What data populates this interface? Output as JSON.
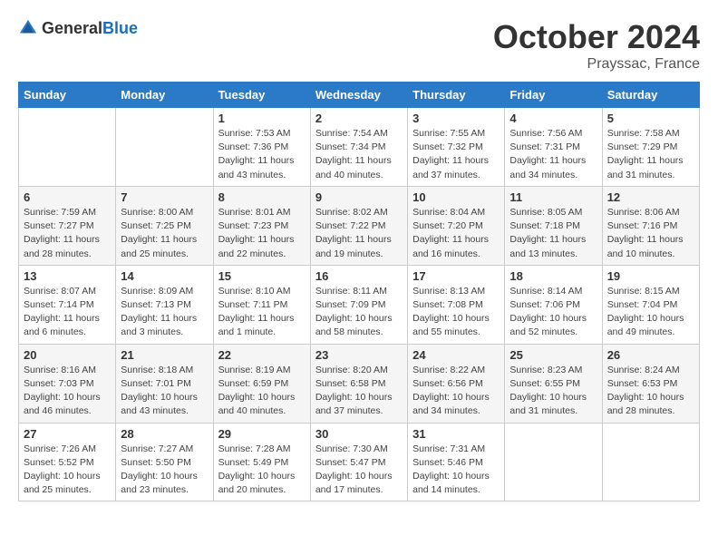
{
  "logo": {
    "text_general": "General",
    "text_blue": "Blue"
  },
  "title": "October 2024",
  "subtitle": "Prayssac, France",
  "headers": [
    "Sunday",
    "Monday",
    "Tuesday",
    "Wednesday",
    "Thursday",
    "Friday",
    "Saturday"
  ],
  "weeks": [
    [
      {
        "day": "",
        "info": ""
      },
      {
        "day": "",
        "info": ""
      },
      {
        "day": "1",
        "info": "Sunrise: 7:53 AM\nSunset: 7:36 PM\nDaylight: 11 hours\nand 43 minutes."
      },
      {
        "day": "2",
        "info": "Sunrise: 7:54 AM\nSunset: 7:34 PM\nDaylight: 11 hours\nand 40 minutes."
      },
      {
        "day": "3",
        "info": "Sunrise: 7:55 AM\nSunset: 7:32 PM\nDaylight: 11 hours\nand 37 minutes."
      },
      {
        "day": "4",
        "info": "Sunrise: 7:56 AM\nSunset: 7:31 PM\nDaylight: 11 hours\nand 34 minutes."
      },
      {
        "day": "5",
        "info": "Sunrise: 7:58 AM\nSunset: 7:29 PM\nDaylight: 11 hours\nand 31 minutes."
      }
    ],
    [
      {
        "day": "6",
        "info": "Sunrise: 7:59 AM\nSunset: 7:27 PM\nDaylight: 11 hours\nand 28 minutes."
      },
      {
        "day": "7",
        "info": "Sunrise: 8:00 AM\nSunset: 7:25 PM\nDaylight: 11 hours\nand 25 minutes."
      },
      {
        "day": "8",
        "info": "Sunrise: 8:01 AM\nSunset: 7:23 PM\nDaylight: 11 hours\nand 22 minutes."
      },
      {
        "day": "9",
        "info": "Sunrise: 8:02 AM\nSunset: 7:22 PM\nDaylight: 11 hours\nand 19 minutes."
      },
      {
        "day": "10",
        "info": "Sunrise: 8:04 AM\nSunset: 7:20 PM\nDaylight: 11 hours\nand 16 minutes."
      },
      {
        "day": "11",
        "info": "Sunrise: 8:05 AM\nSunset: 7:18 PM\nDaylight: 11 hours\nand 13 minutes."
      },
      {
        "day": "12",
        "info": "Sunrise: 8:06 AM\nSunset: 7:16 PM\nDaylight: 11 hours\nand 10 minutes."
      }
    ],
    [
      {
        "day": "13",
        "info": "Sunrise: 8:07 AM\nSunset: 7:14 PM\nDaylight: 11 hours\nand 6 minutes."
      },
      {
        "day": "14",
        "info": "Sunrise: 8:09 AM\nSunset: 7:13 PM\nDaylight: 11 hours\nand 3 minutes."
      },
      {
        "day": "15",
        "info": "Sunrise: 8:10 AM\nSunset: 7:11 PM\nDaylight: 11 hours\nand 1 minute."
      },
      {
        "day": "16",
        "info": "Sunrise: 8:11 AM\nSunset: 7:09 PM\nDaylight: 10 hours\nand 58 minutes."
      },
      {
        "day": "17",
        "info": "Sunrise: 8:13 AM\nSunset: 7:08 PM\nDaylight: 10 hours\nand 55 minutes."
      },
      {
        "day": "18",
        "info": "Sunrise: 8:14 AM\nSunset: 7:06 PM\nDaylight: 10 hours\nand 52 minutes."
      },
      {
        "day": "19",
        "info": "Sunrise: 8:15 AM\nSunset: 7:04 PM\nDaylight: 10 hours\nand 49 minutes."
      }
    ],
    [
      {
        "day": "20",
        "info": "Sunrise: 8:16 AM\nSunset: 7:03 PM\nDaylight: 10 hours\nand 46 minutes."
      },
      {
        "day": "21",
        "info": "Sunrise: 8:18 AM\nSunset: 7:01 PM\nDaylight: 10 hours\nand 43 minutes."
      },
      {
        "day": "22",
        "info": "Sunrise: 8:19 AM\nSunset: 6:59 PM\nDaylight: 10 hours\nand 40 minutes."
      },
      {
        "day": "23",
        "info": "Sunrise: 8:20 AM\nSunset: 6:58 PM\nDaylight: 10 hours\nand 37 minutes."
      },
      {
        "day": "24",
        "info": "Sunrise: 8:22 AM\nSunset: 6:56 PM\nDaylight: 10 hours\nand 34 minutes."
      },
      {
        "day": "25",
        "info": "Sunrise: 8:23 AM\nSunset: 6:55 PM\nDaylight: 10 hours\nand 31 minutes."
      },
      {
        "day": "26",
        "info": "Sunrise: 8:24 AM\nSunset: 6:53 PM\nDaylight: 10 hours\nand 28 minutes."
      }
    ],
    [
      {
        "day": "27",
        "info": "Sunrise: 7:26 AM\nSunset: 5:52 PM\nDaylight: 10 hours\nand 25 minutes."
      },
      {
        "day": "28",
        "info": "Sunrise: 7:27 AM\nSunset: 5:50 PM\nDaylight: 10 hours\nand 23 minutes."
      },
      {
        "day": "29",
        "info": "Sunrise: 7:28 AM\nSunset: 5:49 PM\nDaylight: 10 hours\nand 20 minutes."
      },
      {
        "day": "30",
        "info": "Sunrise: 7:30 AM\nSunset: 5:47 PM\nDaylight: 10 hours\nand 17 minutes."
      },
      {
        "day": "31",
        "info": "Sunrise: 7:31 AM\nSunset: 5:46 PM\nDaylight: 10 hours\nand 14 minutes."
      },
      {
        "day": "",
        "info": ""
      },
      {
        "day": "",
        "info": ""
      }
    ]
  ]
}
